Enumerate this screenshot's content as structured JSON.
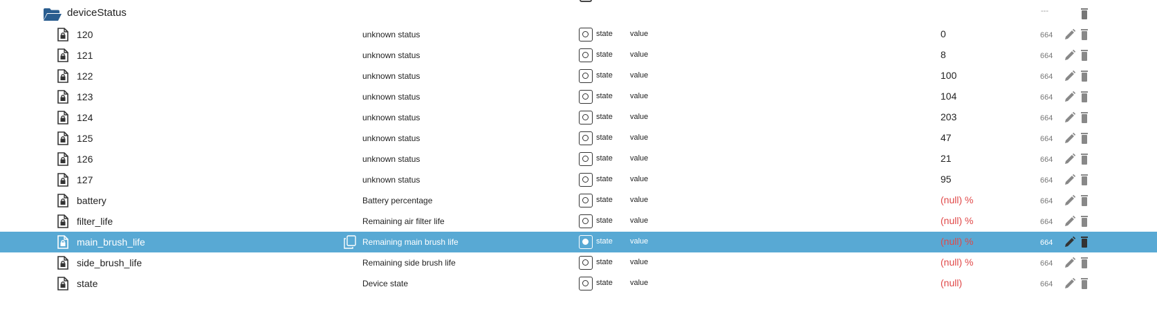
{
  "folder": {
    "name": "deviceStatus",
    "acl": "---"
  },
  "rows": [
    {
      "name": "120",
      "description": "unknown status",
      "role": "state",
      "type": "value",
      "value": "0",
      "acl": "664"
    },
    {
      "name": "121",
      "description": "unknown status",
      "role": "state",
      "type": "value",
      "value": "8",
      "acl": "664"
    },
    {
      "name": "122",
      "description": "unknown status",
      "role": "state",
      "type": "value",
      "value": "100",
      "acl": "664"
    },
    {
      "name": "123",
      "description": "unknown status",
      "role": "state",
      "type": "value",
      "value": "104",
      "acl": "664"
    },
    {
      "name": "124",
      "description": "unknown status",
      "role": "state",
      "type": "value",
      "value": "203",
      "acl": "664"
    },
    {
      "name": "125",
      "description": "unknown status",
      "role": "state",
      "type": "value",
      "value": "47",
      "acl": "664"
    },
    {
      "name": "126",
      "description": "unknown status",
      "role": "state",
      "type": "value",
      "value": "21",
      "acl": "664"
    },
    {
      "name": "127",
      "description": "unknown status",
      "role": "state",
      "type": "value",
      "value": "95",
      "acl": "664"
    },
    {
      "name": "battery",
      "description": "Battery percentage",
      "role": "state",
      "type": "value",
      "value": "(null) %",
      "acl": "664"
    },
    {
      "name": "filter_life",
      "description": "Remaining air filter life",
      "role": "state",
      "type": "value",
      "value": "(null) %",
      "acl": "664"
    },
    {
      "name": "main_brush_life",
      "description": "Remaining main brush life",
      "role": "state",
      "type": "value",
      "value": "(null) %",
      "acl": "664"
    },
    {
      "name": "side_brush_life",
      "description": "Remaining side brush life",
      "role": "state",
      "type": "value",
      "value": "(null) %",
      "acl": "664"
    },
    {
      "name": "state",
      "description": "Device state",
      "role": "state",
      "type": "value",
      "value": "(null)",
      "acl": "664"
    }
  ],
  "selected_row": "main_brush_life",
  "colors": {
    "selected_bg": "#58a9d4",
    "null_value": "#e04848",
    "folder": "#2a5d8f"
  },
  "icons": {
    "folder": "folder-open-icon",
    "file": "file-lock-icon",
    "role": "state-circle-icon",
    "edit": "pencil-icon",
    "delete": "trash-icon",
    "copy": "copy-icon"
  }
}
